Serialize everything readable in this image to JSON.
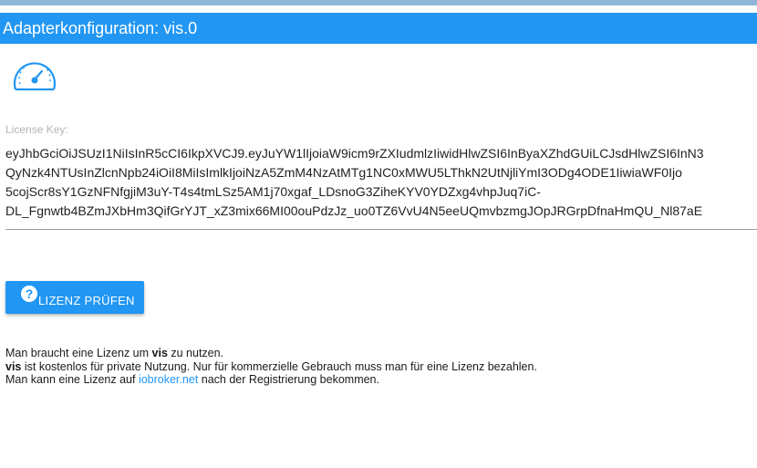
{
  "window": {
    "title": "Adapterkonfiguration: vis.0"
  },
  "logo": {
    "icon": "speedometer-icon",
    "color": "#2196f3"
  },
  "license": {
    "label": "License Key:",
    "lines": [
      "eyJhbGciOiJSUzI1NiIsInR5cCI6IkpXVCJ9.eyJuYW1lIjoiaW9icm9rZXIudmlzIiwidHlwZSI6InByaXZhdGUiLCJsdHlwZSI6InN3",
      "QyNzk4NTUsInZlcnNpb24iOiI8MiIsImlkIjoiNzA5ZmM4NzAtMTg1NC0xMWU5LThkN2UtNjliYmI3ODg4ODE1IiwiaWF0Ijo",
      "5cojScr8sY1GzNFNfgjiM3uY-T4s4tmLSz5AM1j70xgaf_LDsnoG3ZiheKYV0YDZxg4vhpJuq7iC-",
      "DL_Fgnwtb4BZmJXbHm3QifGrYJT_xZ3mix66MI00ouPdzJz_uo0TZ6VvU4N5eeUQmvbzmgJOpJRGrpDfnaHmQU_Nl87aE"
    ]
  },
  "actions": {
    "check_label": "LIZENZ PRÜFEN",
    "check_icon": "help-circle-icon"
  },
  "info": {
    "line1_pre": "Man braucht eine Lizenz um ",
    "line1_bold": "vis",
    "line1_post": " zu nutzen.",
    "line2_bold": "vis",
    "line2_post": " ist kostenlos für private Nutzung. Nur für kommerzielle Gebrauch muss man für eine Lizenz bezahlen.",
    "line3_pre": "Man kann eine Lizenz auf ",
    "line3_link": "iobroker.net",
    "line3_post": " nach der Registrierung bekommen."
  },
  "colors": {
    "accent": "#2196f3",
    "label": "#b4b4b4"
  }
}
